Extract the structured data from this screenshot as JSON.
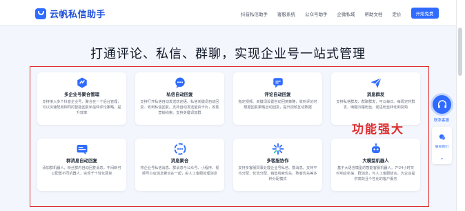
{
  "header": {
    "brand": "云帆私信助手",
    "nav": [
      "抖音私信助手",
      "客服系统",
      "公众号助手",
      "企微私域",
      "帮助文档",
      "定价"
    ],
    "cta": "开始免费"
  },
  "headline": "打通评论、私信、群聊，实现企业号一站式管理",
  "annotation": "功能强大",
  "features": [
    {
      "icon": "aggregate-icon",
      "title": "多企业号聚合管理",
      "desc": "支持接入多个抖音企业号，聚合在一个后台管理，可以快速配用相同的智能回复私信和评论策略，提升效率"
    },
    {
      "icon": "chat-bubble-icon",
      "title": "私信自动回复",
      "desc": "支持打开私信自动发送欢迎语、私信关键词自动回复、收到私信回复。支持自动发送留资卡片，收集营销线索。支持关键词加群"
    },
    {
      "icon": "comment-reply-icon",
      "title": "评论自动回复",
      "desc": "指定视频、关键词设置自动回复策略，收到评论时根据回复策略自动回复，提升视频互动数据"
    },
    {
      "icon": "send-icon",
      "title": "消息群发",
      "desc": "支持私信群发、群聊群发，可以每日、每周定时群发，唤醒沉睡粉丝，促进粉丝转化和复购"
    },
    {
      "icon": "group-chat-icon",
      "title": "群消息自动回复",
      "desc": "添加群机器人，粉丝群内自动回复消息，不间断可以配置不同机器人，实现千个性化回复"
    },
    {
      "icon": "merge-icon",
      "title": "消息聚合",
      "desc": "将企业号私信消息、群消息与公众号、小程序、视频号小店消息聚合在一起，由人工客服处理消息"
    },
    {
      "icon": "sparkle-icon",
      "title": "多客服协作",
      "desc": "支持多客服同事处理企业号私信、群消息。支持平均分配、轮流分配、销售线索优先、熟客优先等多种分配模式"
    },
    {
      "icon": "robot-icon",
      "title": "大模型机器人",
      "desc": "基于大语言模型的智能客服机器人，7*24小时实时响应私信、群消息，与人工客服结合，为企业提供高效且个性化的客户服务"
    }
  ],
  "floating": {
    "service_label": "联系客服",
    "mini_label": "联系我们"
  },
  "colors": {
    "brand": "#2f6bff",
    "annotation": "#e02d2d"
  }
}
